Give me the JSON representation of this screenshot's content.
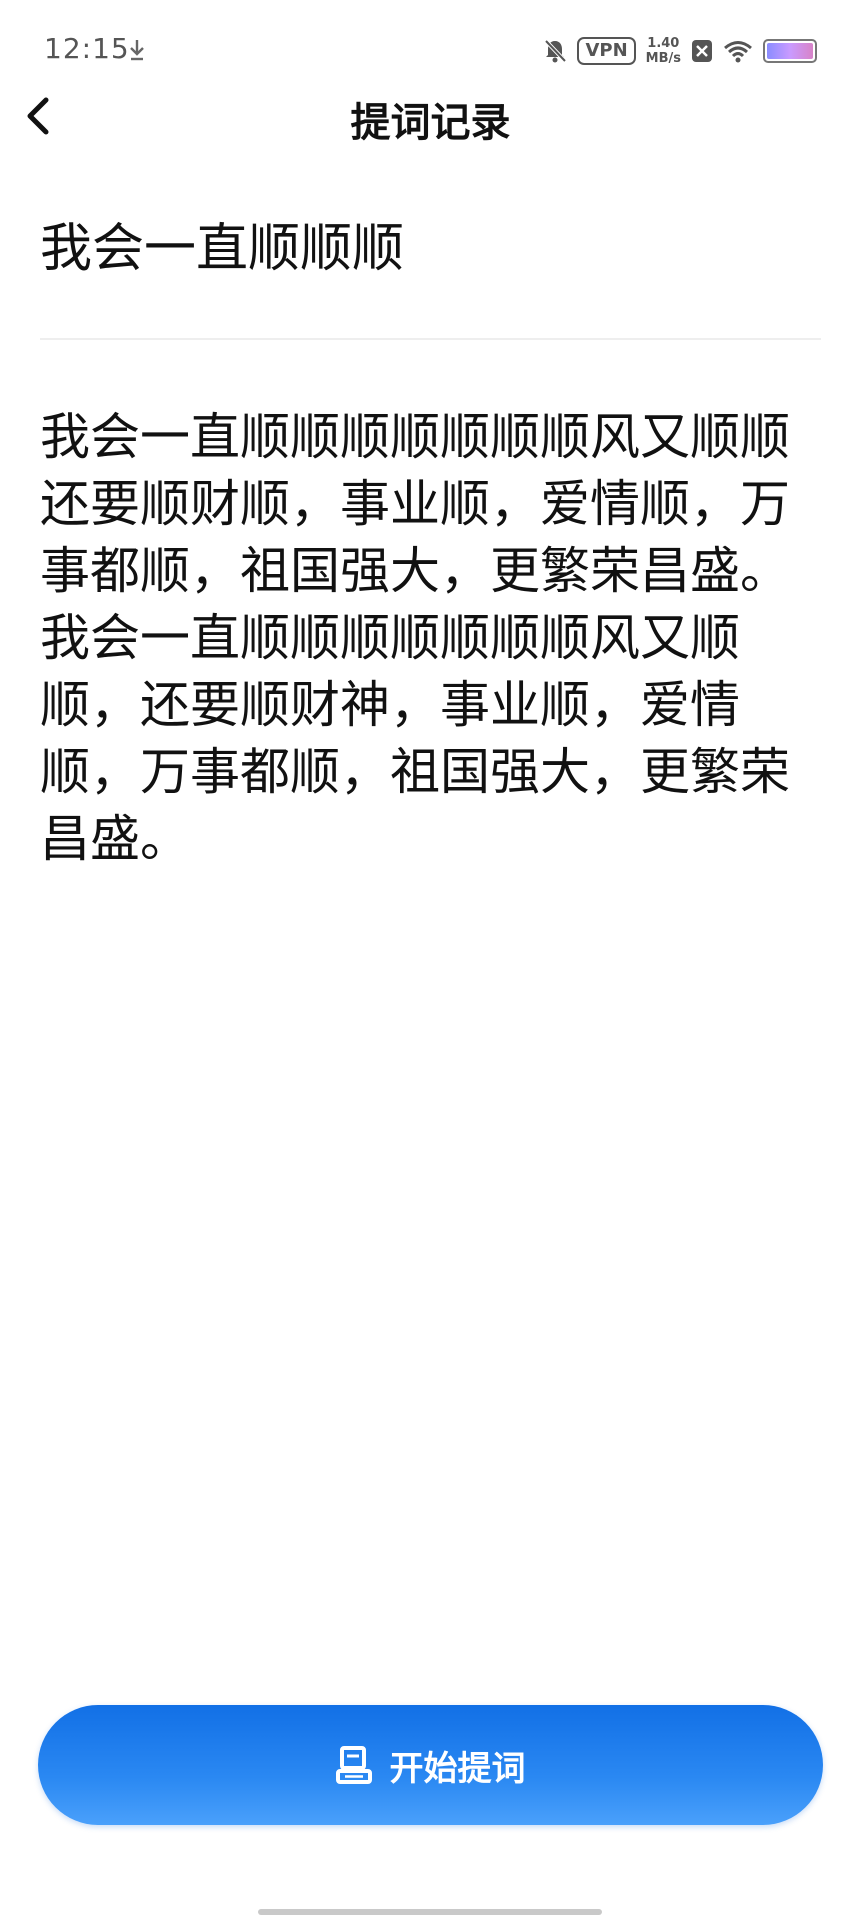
{
  "status_bar": {
    "time": "12:15",
    "vpn": "VPN",
    "speed_value": "1.40",
    "speed_unit": "MB/s"
  },
  "nav": {
    "title": "提词记录"
  },
  "record": {
    "title": "我会一直顺顺顺",
    "body": "我会一直顺顺顺顺顺顺顺风又顺顺还要顺财顺，事业顺，爱情顺，万事都顺，祖国强大，更繁荣昌盛。我会一直顺顺顺顺顺顺顺风又顺顺，还要顺财神，事业顺，爱情顺，万事都顺，祖国强大，更繁荣昌盛。"
  },
  "actions": {
    "start_label": "开始提词"
  },
  "colors": {
    "accent": "#1E7FEE",
    "text": "#111111",
    "divider": "#EEEEEE"
  },
  "icons": {
    "back": "chevron-left-icon",
    "start": "teleprompter-icon",
    "download": "download-icon",
    "mute": "bell-off-icon",
    "wifi": "wifi-icon"
  }
}
